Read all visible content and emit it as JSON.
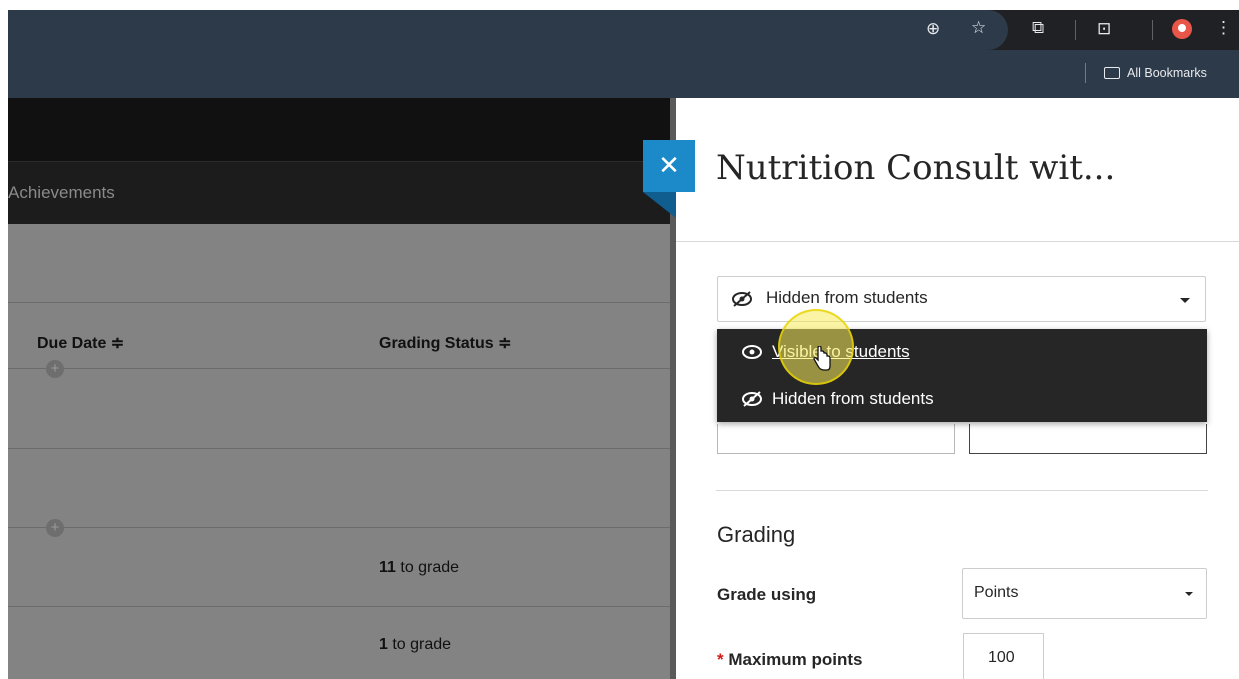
{
  "browser": {
    "bookmarks_label": "All Bookmarks",
    "icons": [
      "zoom-icon",
      "star-icon",
      "extensions-icon",
      "tab-search-icon",
      "profile-avatar",
      "more-menu-icon"
    ]
  },
  "page": {
    "nav_text": "Achievements",
    "columns": {
      "due_date": "Due Date ≑",
      "grading_status": "Grading Status ≑"
    },
    "rows": [
      {
        "count": "11",
        "suffix": " to grade"
      },
      {
        "count": "1",
        "suffix": " to grade"
      }
    ]
  },
  "panel": {
    "title": "Nutrition Consult wit...",
    "visibility": {
      "selected": "Hidden from students",
      "options": [
        "Visible to students",
        "Hidden from students"
      ]
    },
    "grading": {
      "heading": "Grading",
      "grade_using_label": "Grade using",
      "grade_using_value": "Points",
      "max_points_required": "*",
      "max_points_label": " Maximum points",
      "max_points_value": "100"
    }
  },
  "colors": {
    "accent": "#1c8ac9",
    "menu_bg": "#262626",
    "overlay": "#838383"
  }
}
